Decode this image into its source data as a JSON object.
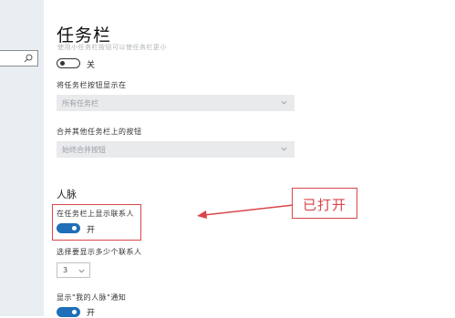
{
  "page": {
    "title": "任务栏",
    "subtitle": "使用小任务栏按钮可以使任务栏更小"
  },
  "top_toggle": {
    "state_label": "关"
  },
  "button_display": {
    "label": "将任务栏按钮显示在",
    "value": "所有任务栏"
  },
  "merge_buttons": {
    "label": "合并其他任务栏上的按钮",
    "value": "始终合并按钮"
  },
  "people": {
    "section_title": "人脉",
    "show_contacts": {
      "label": "在任务栏上显示联系人",
      "state_label": "开"
    },
    "count_select": {
      "label": "选择要显示多少个联系人",
      "value": "3"
    },
    "notifications": {
      "label": "显示\"我的人脉\"通知",
      "state_label": "开"
    }
  },
  "annotation": {
    "callout_text": "已打开"
  },
  "colors": {
    "accent": "#1e6fb8",
    "annotation": "#d9454a"
  },
  "icons": {
    "search": "search-icon",
    "dropdown": "chevron-down-icon"
  }
}
